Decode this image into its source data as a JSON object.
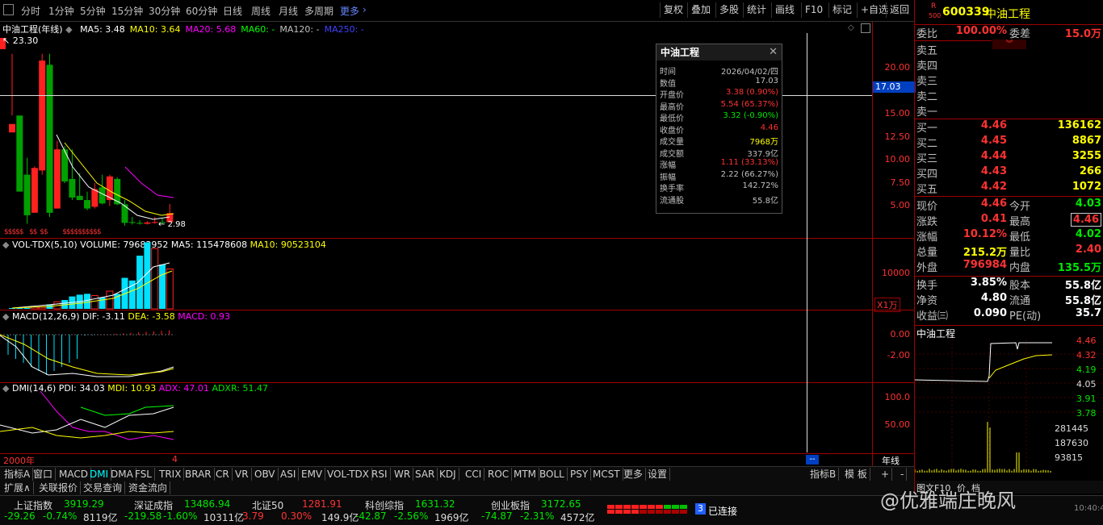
{
  "periods": [
    {
      "label": "分时"
    },
    {
      "label": "1分钟"
    },
    {
      "label": "5分钟"
    },
    {
      "label": "15分钟"
    },
    {
      "label": "30分钟"
    },
    {
      "label": "60分钟"
    },
    {
      "label": "日线"
    },
    {
      "label": "周线"
    },
    {
      "label": "月线"
    },
    {
      "label": "多周期"
    },
    {
      "label": "更多"
    }
  ],
  "toolbar_right": [
    "复权",
    "叠加",
    "多股",
    "统计",
    "画线",
    "F10",
    "标记",
    "+自选",
    "返回"
  ],
  "main_chart": {
    "title": "中油工程(年线)",
    "ma": [
      {
        "label": "MA5: 3.48",
        "color": "#ffffff"
      },
      {
        "label": "MA10: 3.64",
        "color": "#ffff00"
      },
      {
        "label": "MA20: 5.68",
        "color": "#ff00ff"
      },
      {
        "label": "MA60: -",
        "color": "#00ff00"
      },
      {
        "label": "MA120: -",
        "color": "#c0c0c0"
      },
      {
        "label": "MA250: -",
        "color": "#4040ff"
      }
    ],
    "high_label": "23.30",
    "low_label": "2.98",
    "axis": [
      "20.00",
      "15.00",
      "12.50",
      "10.00",
      "7.50",
      "5.00"
    ],
    "crosshair_value": "17.03",
    "x_start": "2000年",
    "x_cursor": "4",
    "x_right": "年线"
  },
  "tooltip": {
    "title": "中油工程",
    "rows": [
      {
        "k": "时间",
        "v": "2026/04/02/四",
        "c": "#c0c0c0"
      },
      {
        "k": "数值",
        "v": "17.03",
        "c": "#c0c0c0"
      },
      {
        "k": "开盘价",
        "v": "3.38 (0.90%)",
        "c": "#ff3232"
      },
      {
        "k": "最高价",
        "v": "5.54 (65.37%)",
        "c": "#ff3232"
      },
      {
        "k": "最低价",
        "v": "3.32 (-0.90%)",
        "c": "#00e600"
      },
      {
        "k": "收盘价",
        "v": "4.46",
        "c": "#ff3232"
      },
      {
        "k": "成交量",
        "v": "7968万",
        "c": "#ffff00"
      },
      {
        "k": "成交额",
        "v": "337.9亿",
        "c": "#c0c0c0"
      },
      {
        "k": "涨幅",
        "v": "1.11 (33.13%)",
        "c": "#ff3232"
      },
      {
        "k": "振幅",
        "v": "2.22 (66.27%)",
        "c": "#c0c0c0"
      },
      {
        "k": "换手率",
        "v": "142.72%",
        "c": "#c0c0c0"
      },
      {
        "k": "流通股",
        "v": "55.8亿",
        "c": "#c0c0c0"
      }
    ]
  },
  "vol": {
    "title": "VOL-TDX(5,10)",
    "volume": "VOLUME: 79683952",
    "ma5": "MA5: 115478608",
    "ma10": "MA10: 90523104",
    "axis": "10000",
    "unit": "X1万"
  },
  "macd": {
    "title": "MACD(12,26,9)",
    "dif": "DIF: -3.11",
    "dea": "DEA: -3.58",
    "macd": "MACD: 0.93",
    "axis": [
      "0.00",
      "-2.00"
    ]
  },
  "dmi": {
    "title": "DMI(14,6)",
    "pdi": "PDI: 34.03",
    "mdi": "MDI: 10.93",
    "adx": "ADX: 47.01",
    "adxr": "ADXR: 51.47",
    "axis": [
      "100.0",
      "50.00"
    ]
  },
  "tabs": [
    "指标A",
    "窗口",
    "MACD",
    "DMI",
    "DMA",
    "FSL",
    "TRIX",
    "BRAR",
    "CR",
    "VR",
    "OBV",
    "ASI",
    "EMV",
    "VOL-TDX",
    "RSI",
    "WR",
    "SAR",
    "KDJ",
    "CCI",
    "ROC",
    "MTM",
    "BOLL",
    "PSY",
    "MCST",
    "更多",
    "设置"
  ],
  "tabs_right": [
    "指标B",
    "模 板",
    "+",
    "-"
  ],
  "tabs2": [
    "扩展∧",
    "关联报价",
    "交易查询",
    "资金流向"
  ],
  "quote": {
    "code": "600339",
    "name": "中油工程",
    "badge": "R",
    "weibi_label": "委比",
    "weibi": "100.00%",
    "weicha_label": "委差",
    "weicha": "15.0万",
    "asks": [
      {
        "label": "卖五"
      },
      {
        "label": "卖四"
      },
      {
        "label": "卖三"
      },
      {
        "label": "卖二"
      },
      {
        "label": "卖一"
      }
    ],
    "bids": [
      {
        "label": "买一",
        "price": "4.46",
        "vol": "136162"
      },
      {
        "label": "买二",
        "price": "4.45",
        "vol": "8867"
      },
      {
        "label": "买三",
        "price": "4.44",
        "vol": "3255"
      },
      {
        "label": "买四",
        "price": "4.43",
        "vol": "266"
      },
      {
        "label": "买五",
        "price": "4.42",
        "vol": "1072"
      }
    ],
    "stats": [
      {
        "l": "现价",
        "m": "4.46",
        "mc": "#ff3232",
        "l2": "今开",
        "r": "4.03",
        "rc": "#00e600"
      },
      {
        "l": "涨跌",
        "m": "0.41",
        "mc": "#ff3232",
        "l2": "最高",
        "r": "4.46",
        "rc": "#ff3232"
      },
      {
        "l": "涨幅",
        "m": "10.12%",
        "mc": "#ff3232",
        "l2": "最低",
        "r": "4.02",
        "rc": "#00e600"
      },
      {
        "l": "总量",
        "m": "215.2万",
        "mc": "#ffff00",
        "l2": "量比",
        "r": "2.40",
        "rc": "#ff3232"
      },
      {
        "l": "外盘",
        "m": "796984",
        "mc": "#ff3232",
        "l2": "内盘",
        "r": "135.5万",
        "rc": "#00e600"
      }
    ],
    "stats2": [
      {
        "l": "换手",
        "m": "3.85%",
        "l2": "股本",
        "r": "55.8亿"
      },
      {
        "l": "净资",
        "m": "4.80",
        "l2": "流通",
        "r": "55.8亿"
      },
      {
        "l": "收益㈢",
        "m": "0.090",
        "l2": "PE(动)",
        "r": "35.7"
      }
    ],
    "mini_title": "中油工程",
    "mini_axis": [
      "4.46",
      "4.32",
      "4.19",
      "4.05",
      "3.91",
      "3.78"
    ],
    "mini_vol_axis": [
      "281445",
      "187630",
      "93815"
    ],
    "mini_tabs": [
      "图文F10",
      "价",
      "档",
      "细",
      "势",
      "联",
      "值",
      "主"
    ]
  },
  "status": {
    "indices": [
      {
        "name": "上证指数",
        "value": "3919.29",
        "chg": "-29.26",
        "pct": "-0.74%",
        "amt": "8119亿",
        "color": "#00e600"
      },
      {
        "name": "深证成指",
        "value": "13486.94",
        "chg": "-219.58",
        "pct": "-1.60%",
        "amt": "10311亿",
        "color": "#00e600"
      },
      {
        "name": "北证50",
        "value": "1281.91",
        "chg": "3.79",
        "pct": "0.30%",
        "amt": "149.9亿",
        "color": "#ff3232"
      },
      {
        "name": "科创综指",
        "value": "1631.32",
        "chg": "-42.87",
        "pct": "-2.56%",
        "amt": "1969亿",
        "color": "#00e600"
      },
      {
        "name": "创业板指",
        "value": "3172.65",
        "chg": "-74.87",
        "pct": "-2.31%",
        "amt": "4572亿",
        "color": "#00e600"
      }
    ],
    "conn_count": "3",
    "conn_label": "已连接",
    "watermark": "@优雅端庄晚风",
    "time": "10:40:49"
  }
}
